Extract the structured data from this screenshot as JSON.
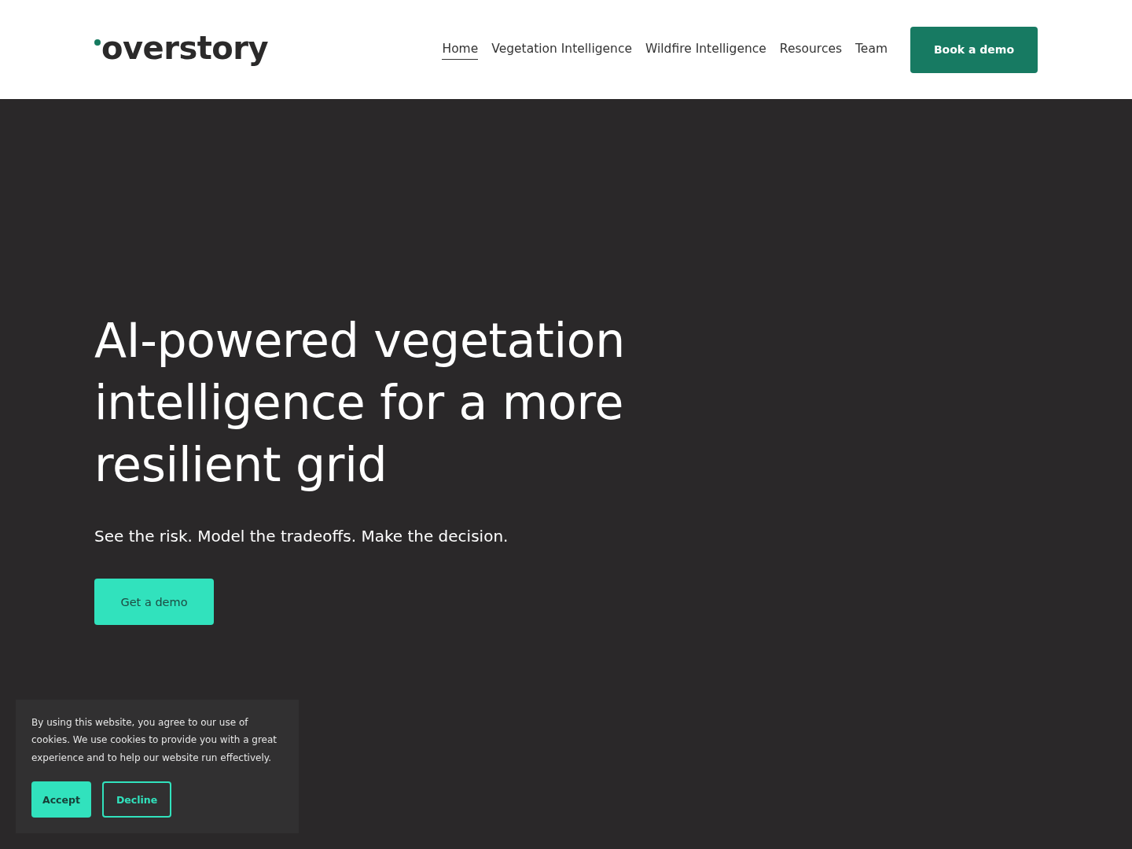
{
  "header": {
    "logo": "overstory",
    "nav": [
      {
        "label": "Home",
        "selected": true
      },
      {
        "label": "Vegetation Intelligence",
        "selected": false
      },
      {
        "label": "Wildfire Intelligence",
        "selected": false
      },
      {
        "label": "Resources",
        "selected": false
      },
      {
        "label": "Team",
        "selected": false
      }
    ],
    "cta": "Book a demo"
  },
  "hero": {
    "heading": "AI-powered vegetation intelligence for a more resilient grid",
    "subheading": "See the risk. Model the tradeoffs. Make the decision.",
    "button": "Get a demo"
  },
  "cookie_banner": {
    "text": "By using this website, you agree to our use of cookies. We use cookies to provide you with a great experience and to help our website run effectively.",
    "buttons": [
      {
        "label": "Accept",
        "kind": "primary"
      },
      {
        "label": "Decline",
        "kind": "outline"
      }
    ]
  }
}
